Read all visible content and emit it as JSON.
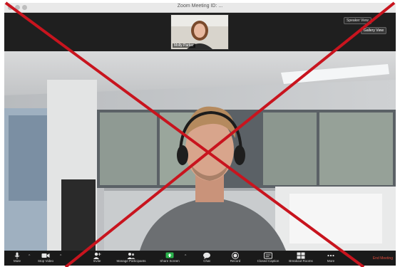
{
  "window": {
    "title": "Zoom Meeting ID: ..."
  },
  "thumbnail": {
    "participant_name": "Molly Parker"
  },
  "view_controls": {
    "speaker_view": "Speaker View",
    "gallery_view": "Gallery View"
  },
  "toolbar": {
    "items": [
      {
        "label": "Mute",
        "icon": "microphone-icon"
      },
      {
        "label": "Stop Video",
        "icon": "video-camera-icon"
      },
      {
        "label": "Invite",
        "icon": "invite-person-icon"
      },
      {
        "label": "Manage Participants",
        "icon": "participants-icon"
      },
      {
        "label": "Share Screen",
        "icon": "share-screen-icon"
      },
      {
        "label": "Chat",
        "icon": "chat-icon"
      },
      {
        "label": "Record",
        "icon": "record-icon"
      },
      {
        "label": "Closed Caption",
        "icon": "closed-caption-icon"
      },
      {
        "label": "Breakout Rooms",
        "icon": "breakout-rooms-icon"
      },
      {
        "label": "More",
        "icon": "more-icon"
      }
    ],
    "end_label": "End Meeting"
  },
  "colors": {
    "share_accent": "#2bb24c",
    "end_red": "#e04a3c",
    "cross_red": "#c8141e"
  }
}
